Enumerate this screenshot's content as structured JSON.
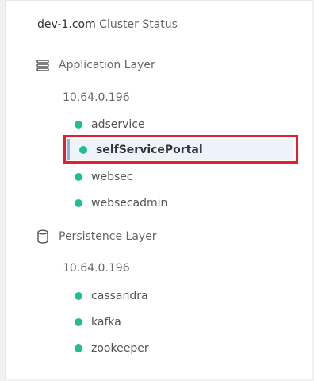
{
  "header": {
    "host": "dev-1.com",
    "subtitle": "Cluster Status"
  },
  "layers": [
    {
      "label": "Application Layer",
      "icon": "stack-icon",
      "hosts": [
        {
          "ip": "10.64.0.196",
          "services": [
            {
              "name": "adservice",
              "status_color": "#1fbf95"
            },
            {
              "name": "selfServicePortal",
              "status_color": "#1fbf95",
              "selected": true
            },
            {
              "name": "websec",
              "status_color": "#1fbf95"
            },
            {
              "name": "websecadmin",
              "status_color": "#1fbf95"
            }
          ]
        }
      ]
    },
    {
      "label": "Persistence Layer",
      "icon": "database-icon",
      "hosts": [
        {
          "ip": "10.64.0.196",
          "services": [
            {
              "name": "cassandra",
              "status_color": "#1fbf95"
            },
            {
              "name": "kafka",
              "status_color": "#1fbf95"
            },
            {
              "name": "zookeeper",
              "status_color": "#1fbf95"
            }
          ]
        }
      ]
    }
  ],
  "colors": {
    "status_ok": "#1fbf95",
    "selection_border": "#e0202d",
    "selection_bg": "#eef3fb"
  }
}
